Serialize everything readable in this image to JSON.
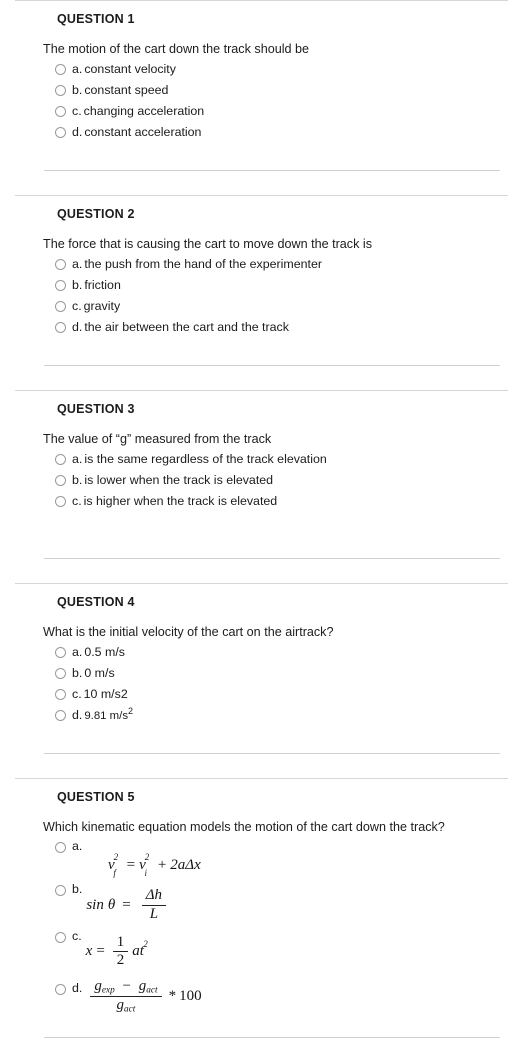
{
  "document": {
    "type": "quiz",
    "divider_color": "#d4d4d4",
    "text_color": "#1c1c1c"
  },
  "questions": [
    {
      "header": "QUESTION 1",
      "prompt": "The motion of the cart down the track should be",
      "options": [
        {
          "letter": "a.",
          "text": "constant velocity"
        },
        {
          "letter": "b.",
          "text": "constant speed"
        },
        {
          "letter": "c.",
          "text": "changing acceleration"
        },
        {
          "letter": "d.",
          "text": "constant acceleration"
        }
      ]
    },
    {
      "header": "QUESTION 2",
      "prompt": "The force that is causing the cart to move down the track is",
      "options": [
        {
          "letter": "a.",
          "text": "the push from the hand of the experimenter"
        },
        {
          "letter": "b.",
          "text": "friction"
        },
        {
          "letter": "c.",
          "text": "gravity"
        },
        {
          "letter": "d.",
          "text": "the air between the cart and the track"
        }
      ]
    },
    {
      "header": "QUESTION 3",
      "prompt": "The value of “g” measured from the track",
      "options": [
        {
          "letter": "a.",
          "text": "is the same regardless of the track elevation"
        },
        {
          "letter": "b.",
          "text": "is lower when the track is elevated"
        },
        {
          "letter": "c.",
          "text": "is higher when the track is elevated"
        }
      ]
    },
    {
      "header": "QUESTION 4",
      "prompt": "What is the initial velocity of the cart on the airtrack?",
      "options": [
        {
          "letter": "a.",
          "text": "0.5 m/s"
        },
        {
          "letter": "b.",
          "text": "0 m/s"
        },
        {
          "letter": "c.",
          "text": "10 m/s2"
        },
        {
          "letter": "d.",
          "text": "9.81 m/s",
          "superscript": "2",
          "alt_font": true
        }
      ]
    },
    {
      "header": "QUESTION 5",
      "prompt": "Which kinematic equation models the motion of the cart down the track?",
      "options": [
        {
          "letter": "a.",
          "formula": "v_f^2 = v_i^2 + 2aΔx"
        },
        {
          "letter": "b.",
          "formula": "sin θ = Δh / L"
        },
        {
          "letter": "c.",
          "formula": "x = (1/2) a t^2"
        },
        {
          "letter": "d.",
          "formula": "(g_exp − g_act) / g_act * 100"
        }
      ]
    }
  ],
  "formula_parts": {
    "q5a": {
      "v": "v",
      "f": "f",
      "i": "i",
      "two": "2",
      "equals": "=",
      "plus": "+",
      "coef": "2a",
      "delta_x": "Δx"
    },
    "q5b": {
      "sin": "sin",
      "theta": "θ",
      "equals": "=",
      "numerator": "Δh",
      "denominator": "L"
    },
    "q5c": {
      "x": "x",
      "equals": "=",
      "one": "1",
      "two": "2",
      "a": "a",
      "t": "t",
      "exp": "2"
    },
    "q5d": {
      "g1": "g",
      "sub1": "exp",
      "minus": "−",
      "g2": "g",
      "sub2": "act",
      "g3": "g",
      "sub3": "act",
      "times": "*",
      "hundred": "100"
    }
  }
}
